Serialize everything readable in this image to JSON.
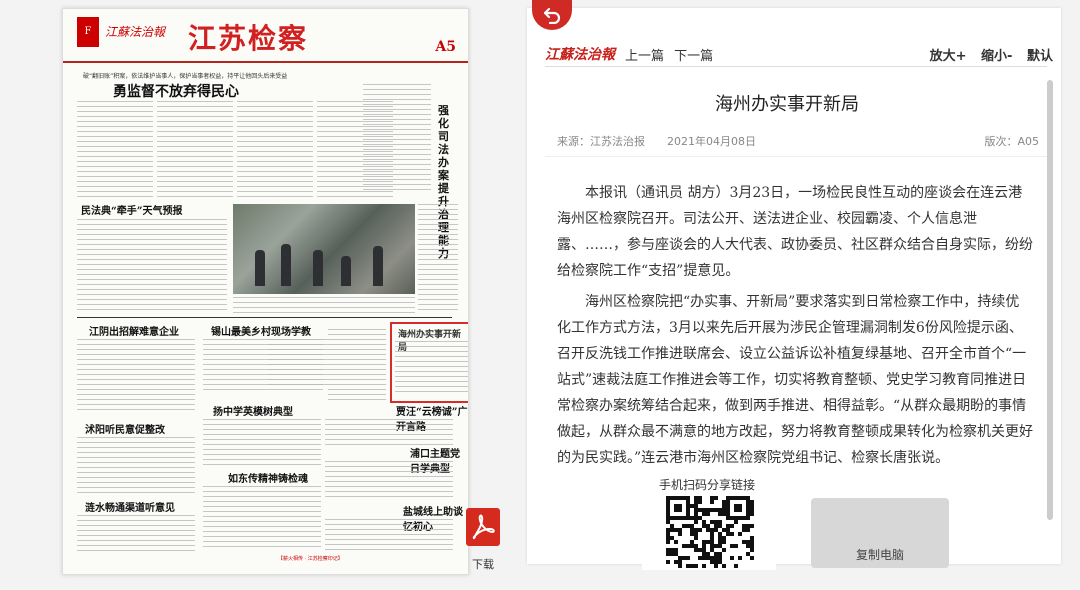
{
  "newspaper": {
    "brand": "江蘇法治報",
    "title": "江苏检察",
    "edition": "A5",
    "lede": "破“翻旧账”积案，依法维护当事人，保护当事者权益，持平让他回头后来受益",
    "headline": "勇监督不放弃得民心",
    "side_title": "强化司法办案 提升治理能力",
    "subheads": {
      "minfa": "民法典“牵手”天气预报",
      "jiangyin": "江阴出招解难意企业",
      "xishan": "锡山最美乡村现场学教",
      "haizhou": "海州办实事开新局",
      "yangzhong": "扬中学英模树典型",
      "jiazhang": "贾汪“云榜诚”广开言路",
      "shuyang": "沭阳听民意促整改",
      "lianyungang": "浦口主题党日学典型",
      "rugao": "如东传精神铸检魂",
      "tongshui": "涟水畅通渠道听意见",
      "yancheng": "盐城线上助谈忆初心"
    },
    "footer": "【薪火相传 · 江苏检察印记】"
  },
  "download": {
    "label": "下载",
    "icon": "pdf-icon"
  },
  "reader": {
    "logo": "江蘇法治報",
    "nav": {
      "prev": "上一篇",
      "next": "下一篇"
    },
    "zoom": {
      "in": "放大+",
      "out": "缩小-",
      "default": "默认"
    },
    "article": {
      "title": "海州办实事开新局",
      "source": "来源：江苏法治报",
      "date": "2021年04月08日",
      "edition": "版次：A05",
      "paragraphs": [
        "本报讯（通讯员 胡方）3月23日，一场检民良性互动的座谈会在连云港海州区检察院召开。司法公开、送法进企业、校园霸凌、个人信息泄露、……，参与座谈会的人大代表、政协委员、社区群众结合自身实际，纷纷给检察院工作“支招”提意见。",
        "海州区检察院把“办实事、开新局”要求落实到日常检察工作中，持续优化工作方式方法，3月以来先后开展为涉民企管理漏洞制发6份风险提示函、召开反洗钱工作推进联席会、设立公益诉讼补植复绿基地、召开全市首个“一站式”速裁法庭工作推进会等工作，切实将教育整顿、党史学习教育同推进日常检察办案统筹结合起来，做到两手推进、相得益彰。“从群众最期盼的事情做起，从群众最不满意的地方改起，努力将教育整顿成果转化为检察机关更好的为民实践。”连云港市海州区检察院党组书记、检察长唐张说。"
      ]
    },
    "share": {
      "qr_label": "手机扫码分享链接",
      "copy_label": "复制电脑"
    }
  },
  "colors": {
    "brand_red": "#d12020",
    "back_red": "#cf2b24"
  }
}
